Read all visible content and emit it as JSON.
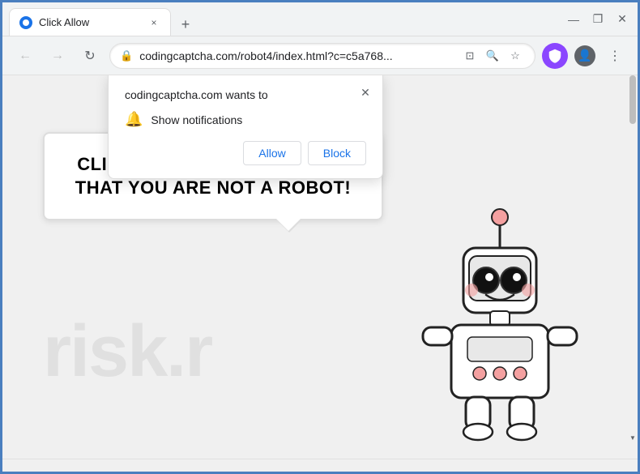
{
  "browser": {
    "tab_title": "Click Allow",
    "tab_close_icon": "×",
    "new_tab_icon": "+",
    "window_minimize": "—",
    "window_maximize": "❐",
    "window_close": "✕"
  },
  "navbar": {
    "back_icon": "←",
    "forward_icon": "→",
    "refresh_icon": "↻",
    "address": "codingcaptcha.com/robot4/index.html?c=c5a768...",
    "lock_icon": "🔒",
    "shield_icon": "🛡",
    "search_icon": "🔍",
    "bookmark_icon": "☆",
    "profile_icon": "👤",
    "more_icon": "⋮",
    "extensions_icon": "⊡"
  },
  "permission_popup": {
    "title": "codingcaptcha.com wants to",
    "close_icon": "✕",
    "notification_label": "Show notifications",
    "allow_button": "Allow",
    "block_button": "Block"
  },
  "page": {
    "watermark": "risk.r",
    "bubble_text": "CLICK «ALLOW» TO CONFIRM THAT YOU ARE NOT A ROBOT!"
  }
}
